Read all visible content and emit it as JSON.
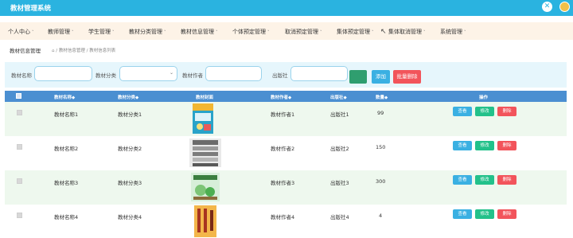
{
  "app": {
    "title": "教材管理系统"
  },
  "nav": {
    "items": [
      "个人中心",
      "教师管理",
      "学生管理",
      "教材分类管理",
      "教材信息管理",
      "个体预定管理",
      "取消预定管理",
      "集体预定管理",
      "集体取消管理",
      "系统管理"
    ],
    "caret": "˅"
  },
  "page": {
    "title": "教材信息管理",
    "breadcrumb": "⌂ / 教材信息管理 / 教材信息列表"
  },
  "search": {
    "name_label": "教材名称",
    "category_label": "教材分类",
    "author_label": "教材作者",
    "publisher_label": "出版社",
    "search_button": "",
    "add_button": "添加",
    "batch_delete_button": "批量删除"
  },
  "table": {
    "headers": [
      "教材名称◆",
      "教材分类◆",
      "教材封面",
      "教材作者◆",
      "出版社◆",
      "数量◆",
      "操作"
    ],
    "rows": [
      {
        "name": "教材名称1",
        "category": "教材分类1",
        "author": "教材作者1",
        "publisher": "出版社1",
        "qty": "99"
      },
      {
        "name": "教材名称2",
        "category": "教材分类2",
        "author": "教材作者2",
        "publisher": "出版社2",
        "qty": "150"
      },
      {
        "name": "教材名称3",
        "category": "教材分类3",
        "author": "教材作者3",
        "publisher": "出版社3",
        "qty": "300"
      },
      {
        "name": "教材名称4",
        "category": "教材分类4",
        "author": "教材作者4",
        "publisher": "出版社4",
        "qty": "4"
      }
    ],
    "actions": {
      "view": "查看",
      "edit": "修改",
      "delete": "删除"
    }
  },
  "colors": {
    "topbar": "#2ab3e0",
    "nav_bg": "#fdf3e7",
    "table_header": "#4b8fd1",
    "row_alt": "#eef8ee",
    "view": "#3ab0e2",
    "edit": "#23c18a",
    "delete": "#f2545b",
    "search": "#2f9e6f",
    "add": "#3ab0e2",
    "batch_delete": "#f2545b"
  }
}
